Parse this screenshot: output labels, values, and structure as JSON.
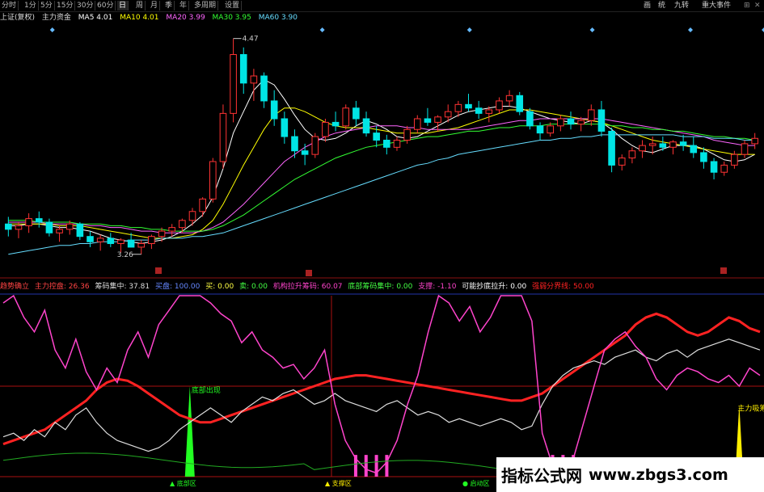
{
  "toolbar": {
    "tabs": [
      "分时",
      "1分",
      "5分",
      "15分",
      "30分",
      "60分",
      "日",
      "周",
      "月",
      "季",
      "年",
      "多周期",
      "设置"
    ],
    "right_tabs": [
      "画",
      "统",
      "九转",
      "重大事件"
    ]
  },
  "colors": {
    "bg": "#000000",
    "up": "#ff3333",
    "down": "#00e5e5",
    "ma5": "#ffffff",
    "ma10": "#ffff00",
    "ma20": "#ff66ff",
    "ma30": "#33ff33",
    "ma60": "#66ddff"
  },
  "legend": {
    "name": "上证(复权)",
    "name2": "主力资金",
    "ma5": "MA5  4.01",
    "ma10": "MA10  4.01",
    "ma20": "MA20  3.99",
    "ma30": "MA30  3.95",
    "ma60": "MA60  3.90"
  },
  "indicator_legend": {
    "i0": "趋势确立",
    "i1": "主力控盘: 26.36",
    "i2": "筹码集中: 37.81",
    "i3": "买盘: 100.00",
    "i4": "买: 0.00",
    "i5": "卖: 0.00",
    "i6": "机构拉升筹码: 60.07",
    "i7": "底部筹码集中: 0.00",
    "i8": "支撑: -1.10",
    "i9": "可能抄底拉升: 0.00",
    "i10": "强弱分界线: 50.00"
  },
  "chart_data": [
    {
      "type": "candlestick",
      "title": "",
      "high_label": "4.47",
      "low_label": "3.26",
      "ohlc": [
        [
          3.43,
          3.47,
          3.36,
          3.4
        ],
        [
          3.4,
          3.44,
          3.35,
          3.42
        ],
        [
          3.42,
          3.49,
          3.38,
          3.46
        ],
        [
          3.46,
          3.5,
          3.41,
          3.44
        ],
        [
          3.44,
          3.46,
          3.36,
          3.38
        ],
        [
          3.38,
          3.42,
          3.33,
          3.4
        ],
        [
          3.4,
          3.45,
          3.37,
          3.43
        ],
        [
          3.43,
          3.44,
          3.34,
          3.36
        ],
        [
          3.36,
          3.39,
          3.3,
          3.33
        ],
        [
          3.33,
          3.37,
          3.28,
          3.35
        ],
        [
          3.35,
          3.38,
          3.3,
          3.32
        ],
        [
          3.32,
          3.35,
          3.27,
          3.34
        ],
        [
          3.34,
          3.38,
          3.31,
          3.3
        ],
        [
          3.3,
          3.34,
          3.26,
          3.32
        ],
        [
          3.32,
          3.37,
          3.29,
          3.36
        ],
        [
          3.36,
          3.41,
          3.33,
          3.39
        ],
        [
          3.39,
          3.43,
          3.36,
          3.41
        ],
        [
          3.41,
          3.46,
          3.38,
          3.45
        ],
        [
          3.45,
          3.52,
          3.42,
          3.5
        ],
        [
          3.5,
          3.58,
          3.47,
          3.57
        ],
        [
          3.57,
          3.8,
          3.55,
          3.78
        ],
        [
          3.78,
          4.1,
          3.74,
          4.05
        ],
        [
          4.05,
          4.47,
          4.0,
          4.38
        ],
        [
          4.38,
          4.42,
          4.16,
          4.22
        ],
        [
          4.22,
          4.3,
          4.12,
          4.26
        ],
        [
          4.26,
          4.28,
          4.08,
          4.12
        ],
        [
          4.12,
          4.18,
          3.98,
          4.02
        ],
        [
          4.02,
          4.06,
          3.88,
          3.92
        ],
        [
          3.92,
          3.96,
          3.8,
          3.84
        ],
        [
          3.84,
          3.88,
          3.76,
          3.82
        ],
        [
          3.82,
          3.94,
          3.8,
          3.92
        ],
        [
          3.92,
          4.02,
          3.89,
          4.0
        ],
        [
          4.0,
          4.06,
          3.95,
          3.98
        ],
        [
          3.98,
          4.1,
          3.96,
          4.08
        ],
        [
          4.08,
          4.12,
          3.98,
          4.02
        ],
        [
          4.02,
          4.06,
          3.92,
          3.94
        ],
        [
          3.94,
          3.98,
          3.86,
          3.9
        ],
        [
          3.9,
          3.93,
          3.82,
          3.86
        ],
        [
          3.86,
          3.92,
          3.84,
          3.9
        ],
        [
          3.9,
          3.98,
          3.88,
          3.96
        ],
        [
          3.96,
          4.04,
          3.94,
          4.02
        ],
        [
          4.02,
          4.08,
          3.98,
          4.0
        ],
        [
          4.0,
          4.04,
          3.95,
          4.03
        ],
        [
          4.03,
          4.1,
          4.0,
          4.06
        ],
        [
          4.06,
          4.12,
          4.03,
          4.1
        ],
        [
          4.1,
          4.16,
          4.06,
          4.08
        ],
        [
          4.08,
          4.12,
          4.02,
          4.05
        ],
        [
          4.05,
          4.09,
          4.0,
          4.07
        ],
        [
          4.07,
          4.14,
          4.05,
          4.12
        ],
        [
          4.12,
          4.18,
          4.09,
          4.15
        ],
        [
          4.15,
          4.17,
          4.04,
          4.06
        ],
        [
          4.06,
          4.08,
          3.96,
          3.98
        ],
        [
          3.98,
          4.0,
          3.9,
          3.94
        ],
        [
          3.94,
          4.0,
          3.92,
          3.98
        ],
        [
          3.98,
          4.04,
          3.95,
          4.02
        ],
        [
          4.02,
          4.06,
          3.96,
          3.99
        ],
        [
          3.99,
          4.03,
          3.95,
          4.01
        ],
        [
          4.01,
          4.1,
          3.98,
          4.07
        ],
        [
          4.07,
          4.12,
          3.92,
          3.95
        ],
        [
          3.95,
          3.97,
          3.72,
          3.76
        ],
        [
          3.76,
          3.82,
          3.73,
          3.8
        ],
        [
          3.8,
          3.86,
          3.77,
          3.84
        ],
        [
          3.84,
          3.9,
          3.8,
          3.87
        ],
        [
          3.87,
          3.92,
          3.82,
          3.88
        ],
        [
          3.88,
          3.92,
          3.84,
          3.86
        ],
        [
          3.86,
          3.9,
          3.82,
          3.89
        ],
        [
          3.89,
          3.93,
          3.84,
          3.87
        ],
        [
          3.87,
          3.92,
          3.8,
          3.83
        ],
        [
          3.83,
          3.86,
          3.74,
          3.78
        ],
        [
          3.78,
          3.8,
          3.68,
          3.72
        ],
        [
          3.72,
          3.78,
          3.7,
          3.76
        ],
        [
          3.76,
          3.84,
          3.74,
          3.82
        ],
        [
          3.82,
          3.9,
          3.8,
          3.88
        ],
        [
          3.88,
          3.94,
          3.85,
          3.91
        ]
      ],
      "ma_lines": {
        "MA5": [
          3.42,
          3.42,
          3.43,
          3.43,
          3.42,
          3.41,
          3.41,
          3.4,
          3.39,
          3.37,
          3.35,
          3.34,
          3.33,
          3.32,
          3.33,
          3.34,
          3.36,
          3.39,
          3.43,
          3.48,
          3.58,
          3.74,
          3.94,
          4.06,
          4.18,
          4.24,
          4.21,
          4.13,
          4.04,
          3.96,
          3.91,
          3.9,
          3.91,
          3.94,
          3.98,
          4.01,
          3.99,
          3.96,
          3.92,
          3.91,
          3.92,
          3.95,
          3.98,
          4.01,
          4.04,
          4.06,
          4.07,
          4.08,
          4.09,
          4.09,
          4.08,
          4.06,
          4.04,
          4.02,
          4.01,
          4.0,
          3.99,
          4.01,
          4.0,
          3.96,
          3.91,
          3.87,
          3.84,
          3.83,
          3.85,
          3.87,
          3.87,
          3.87,
          3.85,
          3.82,
          3.79,
          3.78,
          3.79,
          3.82
        ],
        "MA10": [
          3.43,
          3.43,
          3.43,
          3.43,
          3.43,
          3.42,
          3.42,
          3.42,
          3.41,
          3.4,
          3.39,
          3.38,
          3.37,
          3.36,
          3.35,
          3.35,
          3.35,
          3.36,
          3.37,
          3.4,
          3.45,
          3.54,
          3.65,
          3.76,
          3.86,
          3.96,
          4.04,
          4.08,
          4.08,
          4.06,
          4.03,
          4.0,
          3.98,
          3.97,
          3.97,
          3.97,
          3.96,
          3.95,
          3.94,
          3.94,
          3.94,
          3.94,
          3.95,
          3.96,
          3.97,
          3.99,
          4.01,
          4.03,
          4.05,
          4.07,
          4.07,
          4.07,
          4.06,
          4.05,
          4.04,
          4.03,
          4.02,
          4.01,
          4.0,
          3.98,
          3.96,
          3.94,
          3.92,
          3.9,
          3.89,
          3.88,
          3.87,
          3.86,
          3.85,
          3.84,
          3.83,
          3.82,
          3.82,
          3.82
        ],
        "MA20": [
          3.44,
          3.44,
          3.44,
          3.44,
          3.43,
          3.43,
          3.43,
          3.43,
          3.42,
          3.42,
          3.41,
          3.41,
          3.4,
          3.39,
          3.39,
          3.38,
          3.38,
          3.38,
          3.38,
          3.39,
          3.41,
          3.44,
          3.49,
          3.54,
          3.6,
          3.66,
          3.72,
          3.78,
          3.82,
          3.86,
          3.89,
          3.92,
          3.94,
          3.95,
          3.96,
          3.97,
          3.98,
          3.98,
          3.98,
          3.97,
          3.97,
          3.96,
          3.96,
          3.96,
          3.96,
          3.96,
          3.97,
          3.98,
          3.99,
          4.0,
          4.01,
          4.01,
          4.02,
          4.02,
          4.02,
          4.02,
          4.02,
          4.02,
          4.02,
          4.01,
          4.0,
          3.99,
          3.98,
          3.97,
          3.96,
          3.95,
          3.94,
          3.93,
          3.92,
          3.9,
          3.89,
          3.88,
          3.87,
          3.87
        ],
        "MA30": [
          3.45,
          3.45,
          3.45,
          3.44,
          3.44,
          3.44,
          3.44,
          3.43,
          3.43,
          3.43,
          3.42,
          3.42,
          3.41,
          3.41,
          3.4,
          3.4,
          3.39,
          3.39,
          3.39,
          3.39,
          3.4,
          3.42,
          3.45,
          3.48,
          3.52,
          3.56,
          3.6,
          3.64,
          3.68,
          3.71,
          3.74,
          3.77,
          3.8,
          3.82,
          3.84,
          3.86,
          3.87,
          3.88,
          3.89,
          3.9,
          3.91,
          3.92,
          3.92,
          3.93,
          3.94,
          3.95,
          3.95,
          3.96,
          3.97,
          3.97,
          3.98,
          3.98,
          3.98,
          3.99,
          3.99,
          3.99,
          3.99,
          3.99,
          3.99,
          3.98,
          3.98,
          3.97,
          3.97,
          3.96,
          3.96,
          3.95,
          3.95,
          3.94,
          3.93,
          3.92,
          3.92,
          3.91,
          3.91,
          3.9
        ],
        "MA60": [
          3.26,
          3.27,
          3.28,
          3.29,
          3.3,
          3.31,
          3.31,
          3.32,
          3.32,
          3.33,
          3.33,
          3.33,
          3.34,
          3.34,
          3.34,
          3.35,
          3.35,
          3.35,
          3.36,
          3.36,
          3.37,
          3.38,
          3.4,
          3.42,
          3.44,
          3.46,
          3.48,
          3.5,
          3.52,
          3.54,
          3.56,
          3.58,
          3.6,
          3.62,
          3.64,
          3.66,
          3.68,
          3.7,
          3.72,
          3.74,
          3.76,
          3.77,
          3.79,
          3.8,
          3.82,
          3.83,
          3.84,
          3.85,
          3.86,
          3.87,
          3.88,
          3.89,
          3.9,
          3.9,
          3.91,
          3.91,
          3.92,
          3.92,
          3.93,
          3.93,
          3.93,
          3.93,
          3.93,
          3.93,
          3.93,
          3.93,
          3.92,
          3.92,
          3.92,
          3.91,
          3.91,
          3.91,
          3.9,
          3.9
        ]
      },
      "ylim": [
        3.2,
        4.55
      ]
    },
    {
      "type": "line",
      "title": "",
      "ylim": [
        0,
        100
      ],
      "reference_lines": [
        50
      ],
      "series": [
        {
          "name": "主力控盘",
          "color": "#ff2222",
          "values": [
            18,
            20,
            22,
            24,
            26,
            30,
            34,
            38,
            42,
            48,
            52,
            54,
            53,
            50,
            46,
            42,
            38,
            34,
            32,
            30,
            30,
            32,
            34,
            36,
            38,
            40,
            42,
            44,
            46,
            48,
            50,
            52,
            54,
            55,
            56,
            56,
            55,
            54,
            53,
            52,
            51,
            50,
            49,
            48,
            47,
            46,
            45,
            44,
            43,
            42,
            42,
            44,
            46,
            50,
            54,
            58,
            62,
            66,
            70,
            74,
            78,
            84,
            88,
            90,
            88,
            84,
            80,
            78,
            80,
            84,
            88,
            86,
            82,
            80
          ]
        },
        {
          "name": "筹码集中",
          "color": "#dddddd",
          "values": [
            22,
            24,
            20,
            26,
            22,
            30,
            26,
            34,
            38,
            30,
            24,
            20,
            18,
            16,
            14,
            16,
            20,
            26,
            30,
            34,
            38,
            34,
            30,
            36,
            40,
            44,
            42,
            46,
            48,
            44,
            40,
            42,
            46,
            42,
            40,
            38,
            36,
            40,
            42,
            38,
            34,
            36,
            34,
            30,
            32,
            30,
            28,
            30,
            32,
            30,
            26,
            28,
            40,
            50,
            56,
            60,
            62,
            64,
            62,
            66,
            68,
            70,
            66,
            64,
            68,
            70,
            66,
            70,
            72,
            74,
            76,
            74,
            72,
            70
          ]
        },
        {
          "name": "机构拉升筹码",
          "color": "#ff44cc",
          "values": [
            96,
            100,
            88,
            80,
            92,
            70,
            60,
            76,
            58,
            48,
            60,
            52,
            70,
            80,
            66,
            84,
            92,
            100,
            100,
            100,
            96,
            90,
            86,
            74,
            80,
            70,
            66,
            60,
            62,
            54,
            60,
            70,
            40,
            20,
            10,
            4,
            2,
            8,
            20,
            40,
            56,
            80,
            100,
            96,
            86,
            94,
            80,
            88,
            100,
            100,
            100,
            86,
            24,
            6,
            2,
            10,
            30,
            50,
            70,
            76,
            80,
            72,
            66,
            54,
            48,
            56,
            60,
            58,
            54,
            52,
            56,
            50,
            60,
            56
          ]
        }
      ],
      "spike_labels": [
        {
          "text": "底部出现",
          "color": "#22ff22"
        },
        {
          "text": "主力吸筹",
          "color": "#ffee00"
        }
      ],
      "bottom_labels": [
        {
          "text": "▲ 底部区",
          "color": "#22ff22"
        },
        {
          "text": "▲ 支撑区",
          "color": "#ffee00"
        },
        {
          "text": "● 启动区",
          "color": "#22ff22"
        }
      ]
    }
  ],
  "watermark": {
    "cn": "指标公式网",
    "url": "www.zbgs3.com"
  }
}
